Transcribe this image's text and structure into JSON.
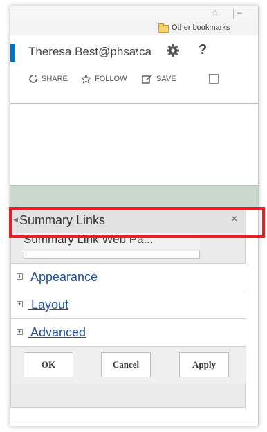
{
  "browser": {
    "bookmarks_label": "Other bookmarks"
  },
  "user": {
    "name": "Theresa.Best@phsa.ca",
    "caret": "▾",
    "help": "?"
  },
  "actions": {
    "share": "SHARE",
    "follow": "FOLLOW",
    "save": "SAVE"
  },
  "panel": {
    "title": "Summary Links",
    "close": "×",
    "webpart_label": "Summary Link Web Pa...",
    "sections": [
      {
        "label": " Appearance"
      },
      {
        "label": " Layout"
      },
      {
        "label": " Advanced"
      }
    ],
    "expander_symbol": "+",
    "buttons": {
      "ok": "OK",
      "cancel": "Cancel",
      "apply": "Apply"
    }
  },
  "colors": {
    "accent_blue": "#0072c6",
    "link": "#1f4fa5",
    "highlight_red": "#ee1c24",
    "ribbon_orange": "#f0b545",
    "band_green": "#c9d8cc"
  }
}
